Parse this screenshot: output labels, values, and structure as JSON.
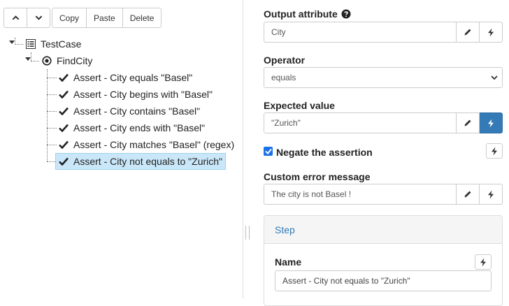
{
  "toolbar": {
    "move_up_icon": "chevron-up-icon",
    "move_down_icon": "chevron-down-icon",
    "copy_label": "Copy",
    "paste_label": "Paste",
    "delete_label": "Delete"
  },
  "tree": {
    "root": {
      "label": "TestCase",
      "icon": "table-list-icon"
    },
    "child": {
      "label": "FindCity",
      "icon": "dot-circle-icon"
    },
    "items": [
      {
        "label": "Assert - City equals \"Basel\"",
        "icon": "check-icon"
      },
      {
        "label": "Assert - City begins with \"Basel\"",
        "icon": "check-icon"
      },
      {
        "label": "Assert - City contains \"Basel\"",
        "icon": "check-icon"
      },
      {
        "label": "Assert - City ends with \"Basel\"",
        "icon": "check-icon"
      },
      {
        "label": "Assert - City matches \"Basel\" (regex)",
        "icon": "check-icon"
      },
      {
        "label": "Assert - City not equals to \"Zurich\"",
        "icon": "check-icon",
        "selected": true
      }
    ]
  },
  "form": {
    "output_attribute": {
      "label": "Output attribute",
      "help_icon": "question-circle-icon",
      "value": "City"
    },
    "operator": {
      "label": "Operator",
      "value": "equals"
    },
    "expected_value": {
      "label": "Expected value",
      "value": "\"Zurich\"",
      "dynamic_active": true
    },
    "negate": {
      "label": "Negate the assertion",
      "checked": true
    },
    "custom_error": {
      "label": "Custom error message",
      "value": "The city is not Basel !"
    },
    "step_panel": {
      "heading": "Step",
      "name_label": "Name",
      "name_value": "Assert - City not equals to \"Zurich\""
    }
  },
  "colors": {
    "accent": "#337ab7",
    "selection_bg": "#c9e7f8",
    "checkbox": "#1a73e8"
  }
}
